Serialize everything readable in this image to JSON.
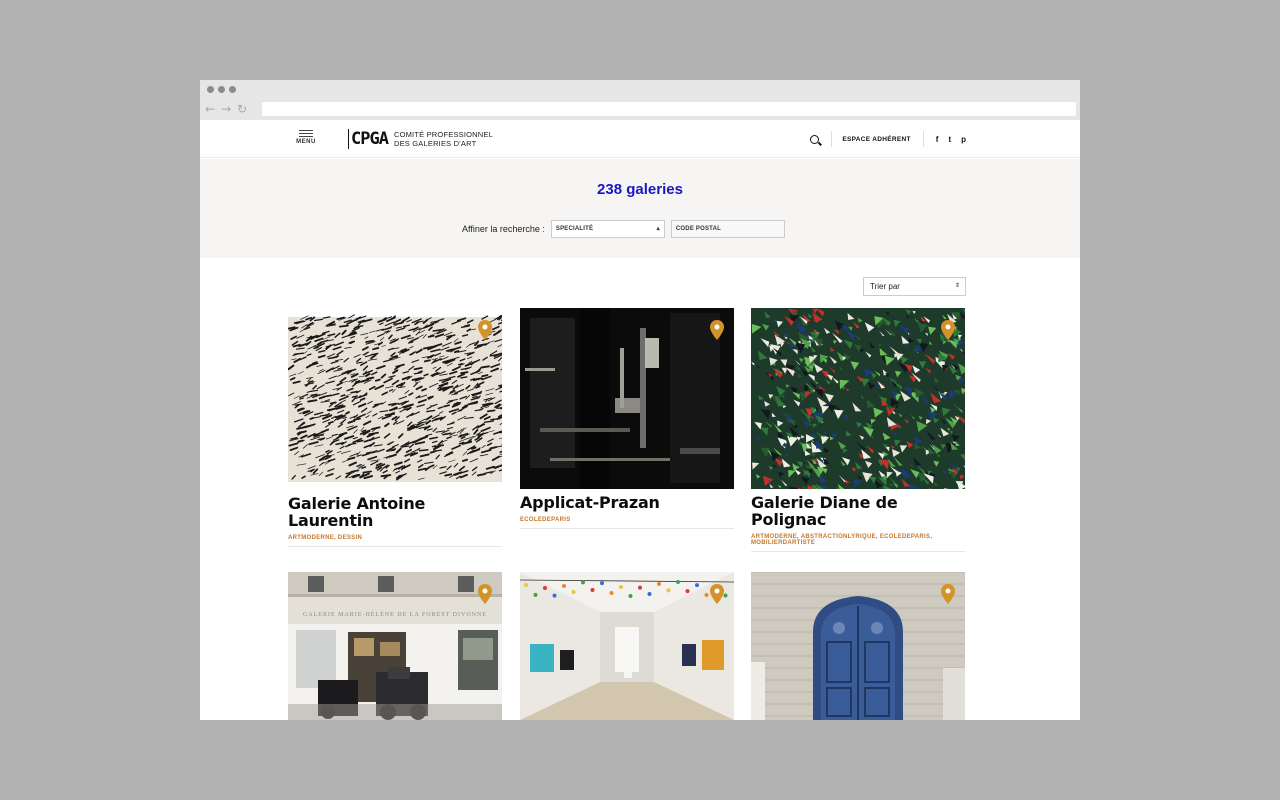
{
  "header": {
    "menu_label": "MENU",
    "logo_mark": "CPGA",
    "logo_line1": "COMITÉ PROFESSIONNEL",
    "logo_line2": "DES GALERIES D'ART",
    "espace_label": "ESPACE ADHÉRENT",
    "social": [
      "f",
      "t",
      "p"
    ]
  },
  "filters": {
    "count": "238 galeries",
    "affiner_label": "Affiner la recherche :",
    "specialite": "SPECIALITÉ",
    "code_postal": "CODE POSTAL",
    "sort_label": "Trier par"
  },
  "galleries": [
    {
      "name": "Galerie Antoine Laurentin",
      "tags": "ARTMODERNE, DESSIN"
    },
    {
      "name": "Applicat-Prazan",
      "tags": "ECOLEDEPARIS"
    },
    {
      "name": "Galerie Diane de Polignac",
      "tags": "ARTMODERNE, ABSTRACTIONLYRIQUE, ECOLEDEPARIS, MOBILIERDARTISTE"
    },
    {
      "name": "",
      "tags": ""
    },
    {
      "name": "",
      "tags": ""
    },
    {
      "name": "",
      "tags": ""
    }
  ],
  "storefront_sign": "GALERIE MARIE-HÉLÈNE DE LA FOREST DIVONNE",
  "colors": {
    "accent": "#1717c4",
    "tag": "#c4772d",
    "pin": "#d4922a"
  }
}
